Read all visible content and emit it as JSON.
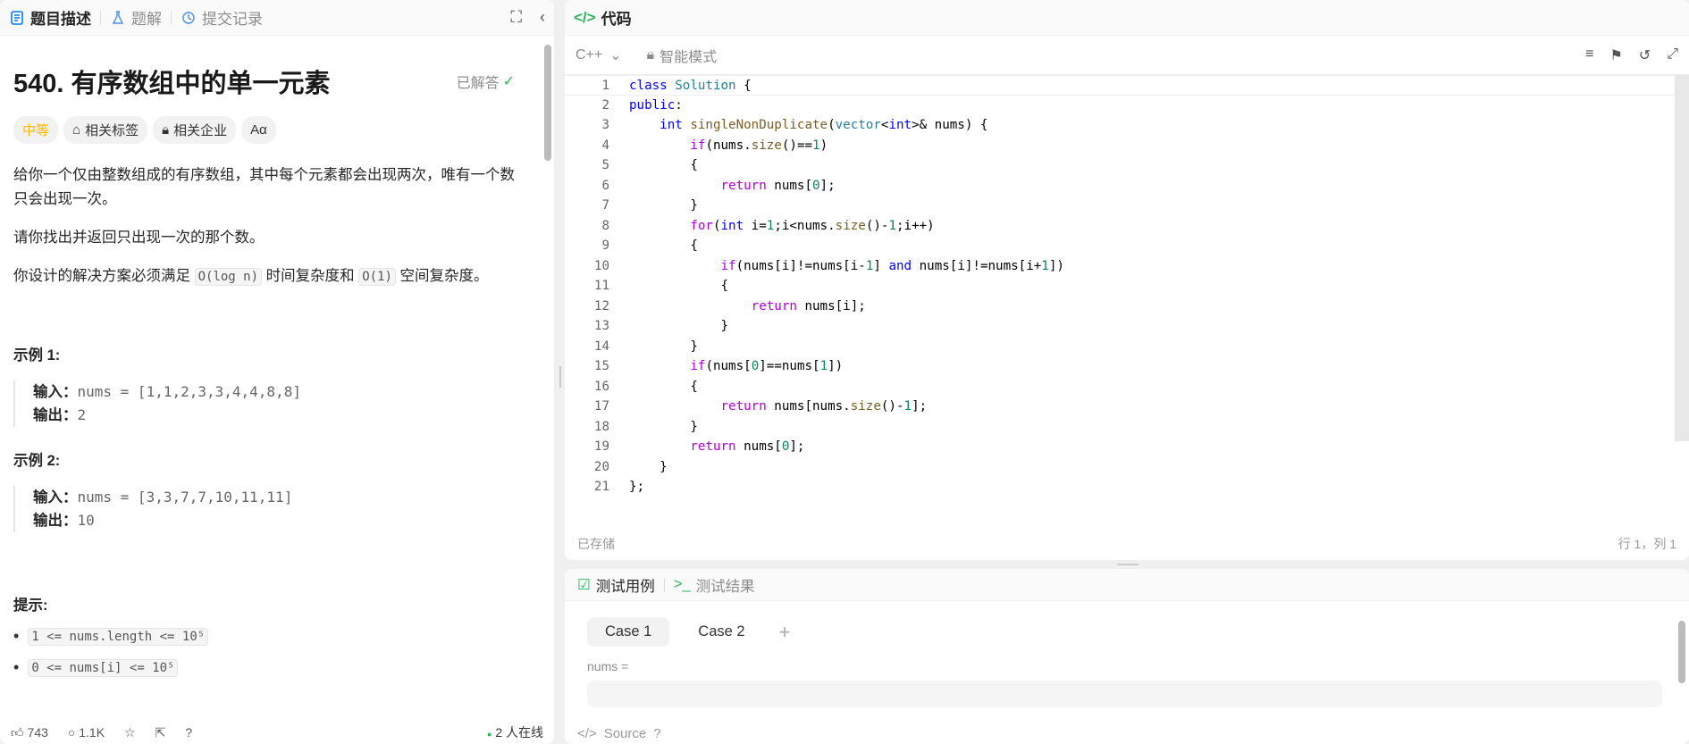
{
  "left_tabs": {
    "description": "题目描述",
    "solution": "题解",
    "submissions": "提交记录"
  },
  "problem": {
    "title": "540. 有序数组中的单一元素",
    "status": "已解答",
    "difficulty": "中等",
    "tags_label": "相关标签",
    "companies_label": "相关企业",
    "font_toggle": "Aα",
    "p1": "给你一个仅由整数组成的有序数组，其中每个元素都会出现两次，唯有一个数只会出现一次。",
    "p2": "请你找出并返回只出现一次的那个数。",
    "p3_a": "你设计的解决方案必须满足 ",
    "p3_code1": "O(log n)",
    "p3_b": " 时间复杂度和 ",
    "p3_code2": "O(1)",
    "p3_c": " 空间复杂度。",
    "ex1_title": "示例 1:",
    "ex1_in_label": "输入：",
    "ex1_in": "nums = [1,1,2,3,3,4,4,8,8]",
    "ex1_out_label": "输出：",
    "ex1_out": "2",
    "ex2_title": "示例 2:",
    "ex2_in_label": "输入：",
    "ex2_in": "nums =  [3,3,7,7,10,11,11]",
    "ex2_out_label": "输出：",
    "ex2_out": "10",
    "hint_title": "提示:",
    "hint1": "1 <= nums.length <= 10⁵",
    "hint2": "0 <= nums[i] <= 10⁵"
  },
  "footer": {
    "likes": "743",
    "comments": "1.1K",
    "online": "2 人在线"
  },
  "code_panel": {
    "title": "代码",
    "language": "C++",
    "mode": "智能模式",
    "saved": "已存储",
    "position": "行 1，列 1"
  },
  "code_lines": [
    "1",
    "2",
    "3",
    "4",
    "5",
    "6",
    "7",
    "8",
    "9",
    "10",
    "11",
    "12",
    "13",
    "14",
    "15",
    "16",
    "17",
    "18",
    "19",
    "20",
    "21"
  ],
  "test_panel": {
    "tab_cases": "测试用例",
    "tab_results": "测试结果",
    "case1": "Case 1",
    "case2": "Case 2",
    "plus": "+",
    "param": "nums =",
    "source": "Source"
  },
  "colors": {
    "accent_green": "#2db55d",
    "difficulty_yellow": "#ffb800"
  }
}
